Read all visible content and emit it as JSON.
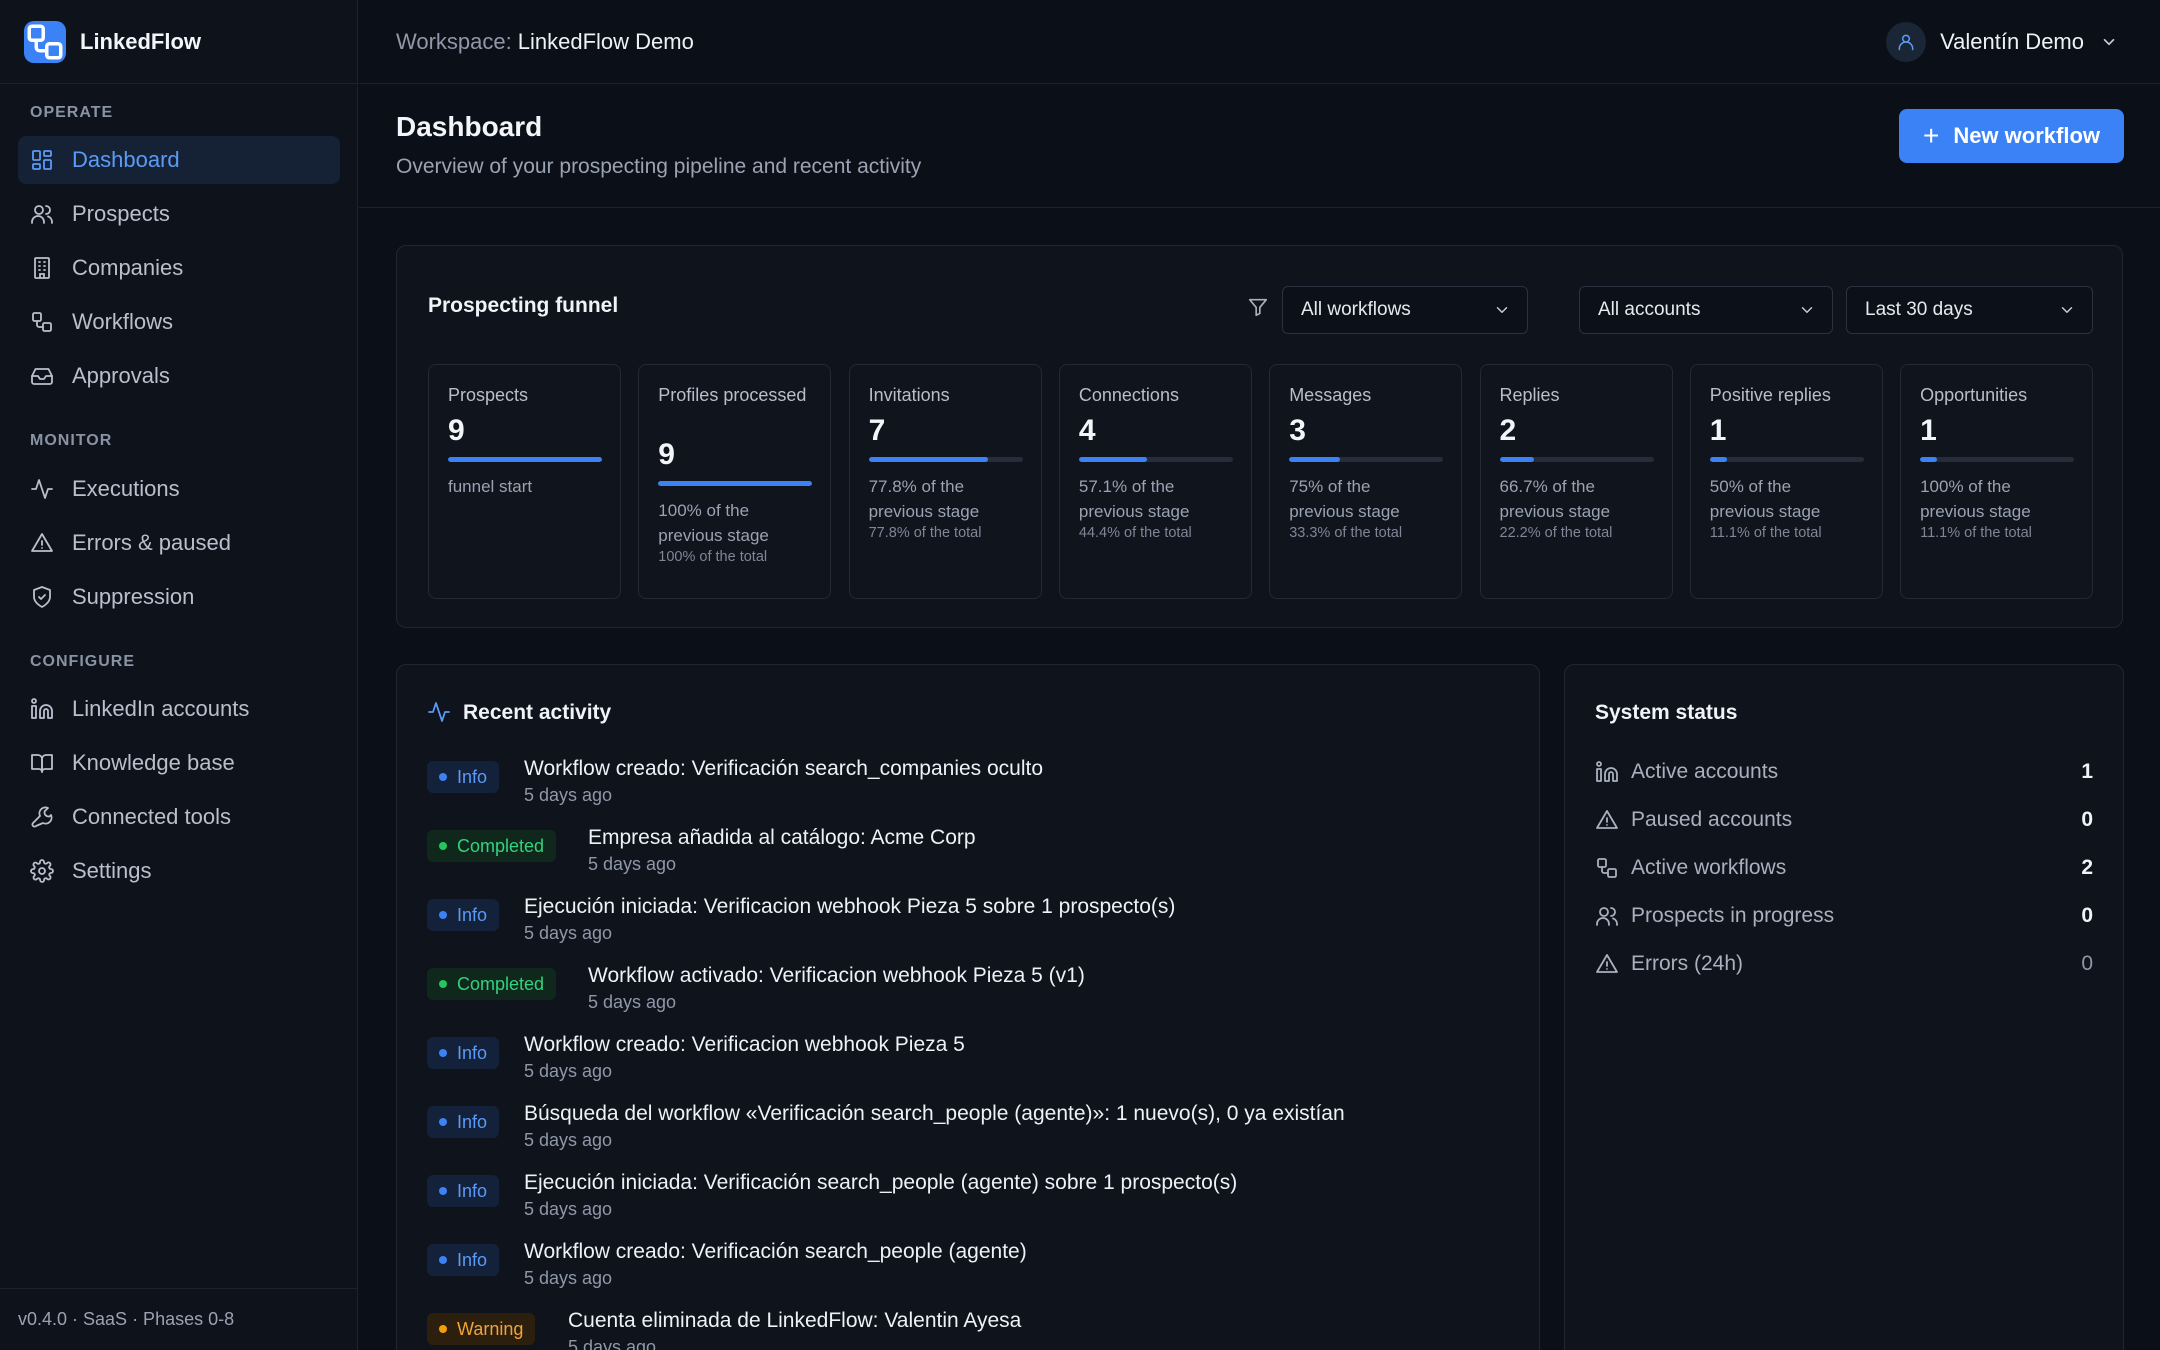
{
  "app": {
    "name": "LinkedFlow",
    "version_footer": "v0.4.0 · SaaS · Phases 0-8"
  },
  "workspace": {
    "label": "Workspace:",
    "name": "LinkedFlow Demo"
  },
  "user": {
    "name": "Valentín Demo"
  },
  "sidebar": {
    "sections": {
      "operate": "OPERATE",
      "monitor": "MONITOR",
      "configure": "CONFIGURE"
    },
    "items": [
      {
        "label": "Dashboard",
        "icon": "grid-icon",
        "active": true
      },
      {
        "label": "Prospects",
        "icon": "users-icon"
      },
      {
        "label": "Companies",
        "icon": "building-icon"
      },
      {
        "label": "Workflows",
        "icon": "workflow-icon"
      },
      {
        "label": "Approvals",
        "icon": "inbox-icon"
      },
      {
        "label": "Executions",
        "icon": "activity-icon"
      },
      {
        "label": "Errors & paused",
        "icon": "warning-icon"
      },
      {
        "label": "Suppression",
        "icon": "shield-icon"
      },
      {
        "label": "LinkedIn accounts",
        "icon": "linkedin-icon"
      },
      {
        "label": "Knowledge base",
        "icon": "book-icon"
      },
      {
        "label": "Connected tools",
        "icon": "wrench-icon"
      },
      {
        "label": "Settings",
        "icon": "gear-icon"
      }
    ]
  },
  "header": {
    "title": "Dashboard",
    "subtitle": "Overview of your prospecting pipeline and recent activity",
    "new_workflow_label": "New workflow"
  },
  "funnel": {
    "title": "Prospecting funnel",
    "filters": {
      "workflow": "All workflows",
      "account": "All accounts",
      "period": "Last 30 days"
    },
    "stages": [
      {
        "label": "Prospects",
        "value": "9",
        "progress": 1.0,
        "note": "funnel start",
        "total": ""
      },
      {
        "label": "Profiles processed",
        "value": "9",
        "progress": 1.0,
        "note": "100% of the previous stage",
        "total": "100% of the total"
      },
      {
        "label": "Invitations",
        "value": "7",
        "progress": 0.778,
        "note": "77.8% of the previous stage",
        "total": "77.8% of the total"
      },
      {
        "label": "Connections",
        "value": "4",
        "progress": 0.444,
        "note": "57.1% of the previous stage",
        "total": "44.4% of the total"
      },
      {
        "label": "Messages",
        "value": "3",
        "progress": 0.333,
        "note": "75% of the previous stage",
        "total": "33.3% of the total"
      },
      {
        "label": "Replies",
        "value": "2",
        "progress": 0.222,
        "note": "66.7% of the previous stage",
        "total": "22.2% of the total"
      },
      {
        "label": "Positive replies",
        "value": "1",
        "progress": 0.111,
        "note": "50% of the previous stage",
        "total": "11.1% of the total"
      },
      {
        "label": "Opportunities",
        "value": "1",
        "progress": 0.111,
        "note": "100% of the previous stage",
        "total": "11.1% of the total"
      }
    ]
  },
  "activity": {
    "title": "Recent activity",
    "items": [
      {
        "level": "info",
        "badge": "Info",
        "text": "Workflow creado: Verificación search_companies oculto",
        "time": "5 days ago"
      },
      {
        "level": "completed",
        "badge": "Completed",
        "text": "Empresa añadida al catálogo: Acme Corp",
        "time": "5 days ago"
      },
      {
        "level": "info",
        "badge": "Info",
        "text": "Ejecución iniciada: Verificacion webhook Pieza 5 sobre 1 prospecto(s)",
        "time": "5 days ago"
      },
      {
        "level": "completed",
        "badge": "Completed",
        "text": "Workflow activado: Verificacion webhook Pieza 5 (v1)",
        "time": "5 days ago"
      },
      {
        "level": "info",
        "badge": "Info",
        "text": "Workflow creado: Verificacion webhook Pieza 5",
        "time": "5 days ago"
      },
      {
        "level": "info",
        "badge": "Info",
        "text": "Búsqueda del workflow «Verificación search_people (agente)»: 1 nuevo(s), 0 ya existían",
        "time": "5 days ago"
      },
      {
        "level": "info",
        "badge": "Info",
        "text": "Ejecución iniciada: Verificación search_people (agente) sobre 1 prospecto(s)",
        "time": "5 days ago"
      },
      {
        "level": "info",
        "badge": "Info",
        "text": "Workflow creado: Verificación search_people (agente)",
        "time": "5 days ago"
      },
      {
        "level": "warning",
        "badge": "Warning",
        "text": "Cuenta eliminada de LinkedFlow: Valentin Ayesa",
        "time": "5 days ago"
      }
    ]
  },
  "system_status": {
    "title": "System status",
    "rows": [
      {
        "label": "Active accounts",
        "value": "1",
        "icon": "linkedin-icon"
      },
      {
        "label": "Paused accounts",
        "value": "0",
        "icon": "warning-icon"
      },
      {
        "label": "Active workflows",
        "value": "2",
        "icon": "workflow-icon"
      },
      {
        "label": "Prospects in progress",
        "value": "0",
        "icon": "users-icon"
      },
      {
        "label": "Errors (24h)",
        "value": "0",
        "icon": "warning-icon"
      }
    ]
  },
  "colors": {
    "accent": "#3b82f6",
    "background": "#0b0f17",
    "info": "#5b9bf7",
    "completed": "#34d17e",
    "warning": "#f0a33a"
  }
}
